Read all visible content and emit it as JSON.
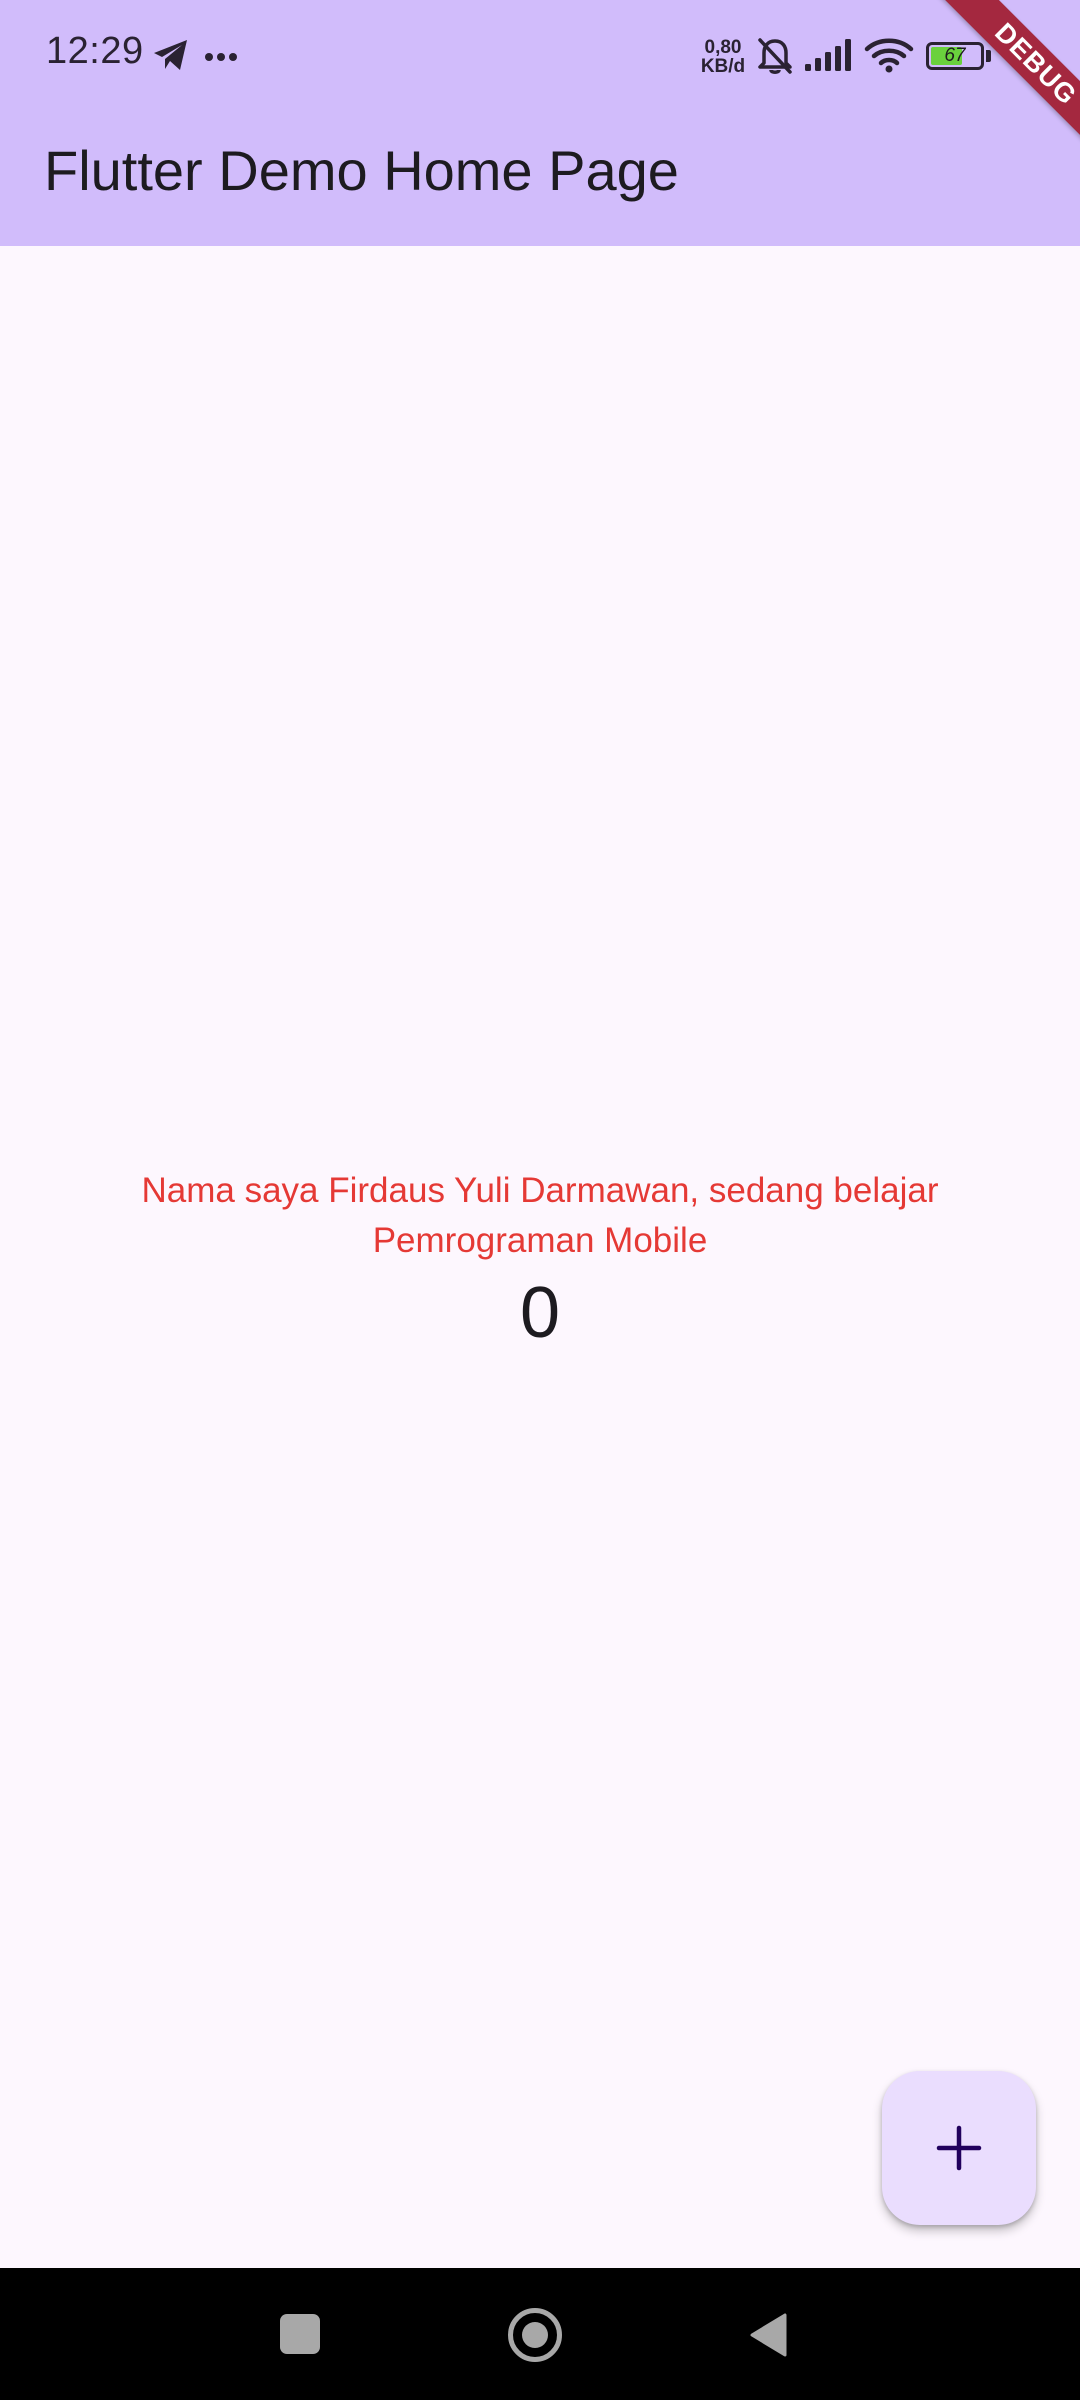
{
  "status_bar": {
    "time": "12:29",
    "net_speed_value": "0,80",
    "net_speed_unit": "KB/d",
    "battery_percent": "67",
    "battery_level": 0.67,
    "icons": [
      "telegram-icon",
      "more-dots-icon",
      "bell-muted-icon",
      "signal-icon",
      "wifi-icon",
      "battery-icon"
    ]
  },
  "app_bar": {
    "title": "Flutter Demo Home Page"
  },
  "debug_banner": {
    "label": "DEBUG",
    "color": "#a4283f"
  },
  "body": {
    "intro_text": "Nama saya Firdaus Yuli Darmawan, sedang belajar Pemrograman Mobile",
    "counter": "0"
  },
  "fab": {
    "icon": "plus-icon"
  },
  "nav_bar": {
    "buttons": [
      "recents-button",
      "home-button",
      "back-button"
    ]
  },
  "colors": {
    "app_bar": "#d1bcfb",
    "background": "#fdf7fe",
    "intro_text": "#e53935",
    "fab": "#eaddfe",
    "nav_bar": "#000000"
  }
}
